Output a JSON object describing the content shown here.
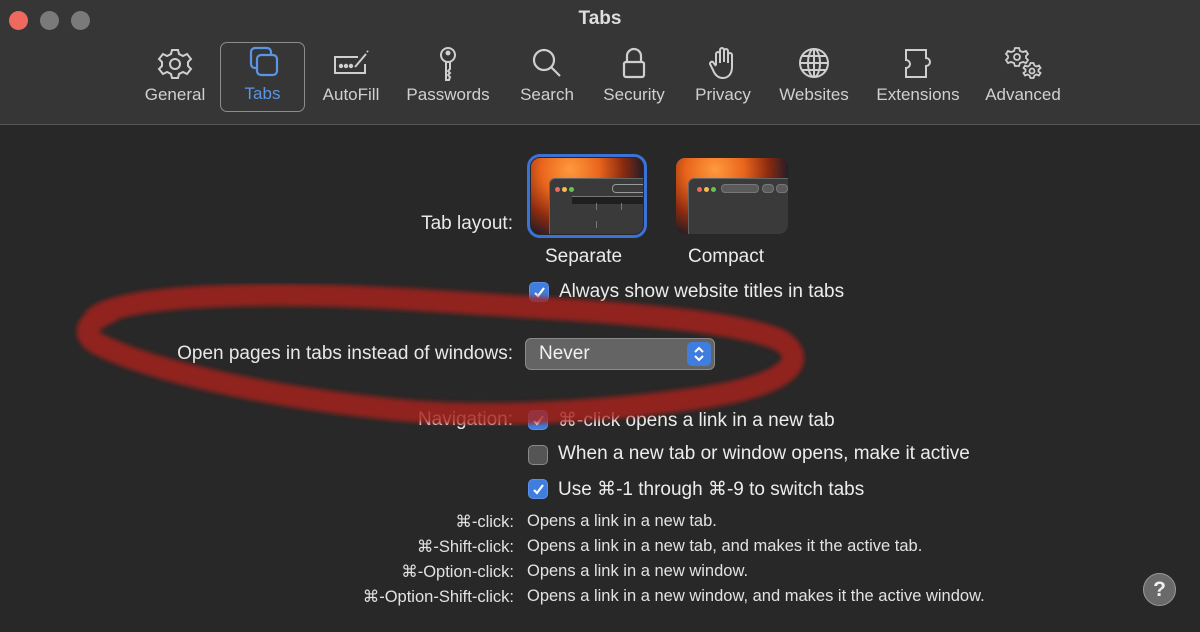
{
  "window": {
    "title": "Tabs",
    "traffic_lights": [
      "close",
      "minimize",
      "zoom"
    ]
  },
  "toolbar": {
    "items": [
      {
        "label": "General",
        "icon": "gear-icon",
        "selected": false
      },
      {
        "label": "Tabs",
        "icon": "tabs-icon",
        "selected": true
      },
      {
        "label": "AutoFill",
        "icon": "autofill-icon",
        "selected": false
      },
      {
        "label": "Passwords",
        "icon": "key-icon",
        "selected": false
      },
      {
        "label": "Search",
        "icon": "search-icon",
        "selected": false
      },
      {
        "label": "Security",
        "icon": "lock-icon",
        "selected": false
      },
      {
        "label": "Privacy",
        "icon": "hand-icon",
        "selected": false
      },
      {
        "label": "Websites",
        "icon": "globe-icon",
        "selected": false
      },
      {
        "label": "Extensions",
        "icon": "puzzle-icon",
        "selected": false
      },
      {
        "label": "Advanced",
        "icon": "gears-icon",
        "selected": false
      }
    ]
  },
  "tab_layout": {
    "label": "Tab layout:",
    "options": [
      {
        "label": "Separate",
        "selected": true
      },
      {
        "label": "Compact",
        "selected": false
      }
    ],
    "always_show_titles": {
      "label": "Always show website titles in tabs",
      "checked": true
    }
  },
  "open_pages": {
    "label": "Open pages in tabs instead of windows:",
    "value": "Never"
  },
  "navigation": {
    "label": "Navigation:",
    "options": [
      {
        "label": "⌘-click opens a link in a new tab",
        "checked": true
      },
      {
        "label": "When a new tab or window opens, make it active",
        "checked": false
      },
      {
        "label": "Use ⌘-1 through ⌘-9 to switch tabs",
        "checked": true
      }
    ]
  },
  "shortcuts": [
    {
      "key": "⌘-click:",
      "desc": "Opens a link in a new tab."
    },
    {
      "key": "⌘-Shift-click:",
      "desc": "Opens a link in a new tab, and makes it the active tab."
    },
    {
      "key": "⌘-Option-click:",
      "desc": "Opens a link in a new window."
    },
    {
      "key": "⌘-Option-Shift-click:",
      "desc": "Opens a link in a new window, and makes it the active window."
    }
  ],
  "help": {
    "label": "?"
  },
  "colors": {
    "accent": "#3f7ddf",
    "selected_tab_label": "#5a95e6",
    "annotation": "#b0231a"
  }
}
